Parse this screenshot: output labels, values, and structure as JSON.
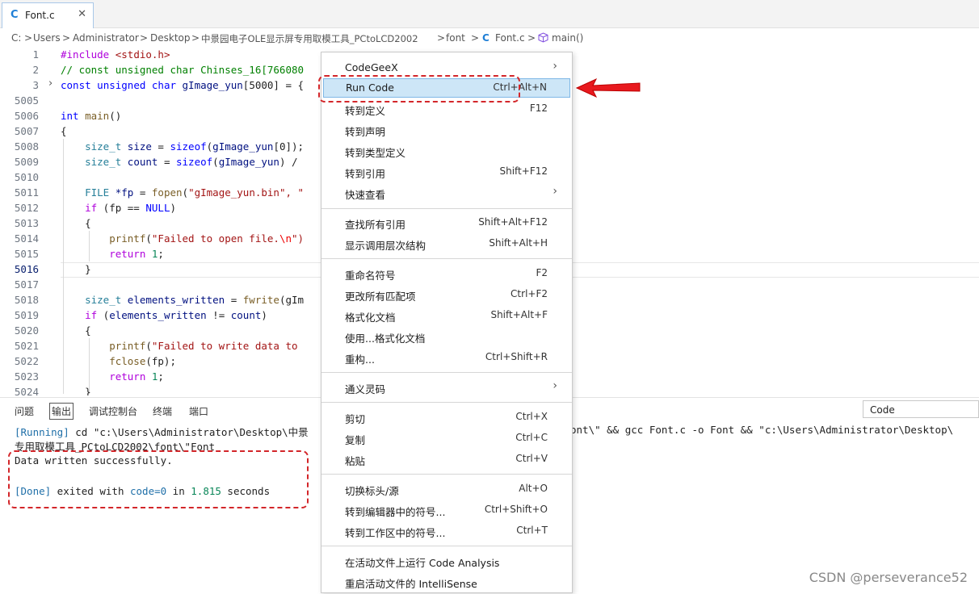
{
  "tab": {
    "icon": "C",
    "label": "Font.c",
    "close": "✕"
  },
  "breadcrumb": [
    "C:",
    "Users",
    "Administrator",
    "Desktop",
    "中景园电子OLE显示屏专用取模工具_PCtoLCD2002",
    "font",
    "Font.c",
    "main()"
  ],
  "breadcrumb_sep": ">",
  "breadcrumb_file_icon": "C",
  "gutter": [
    "1",
    "2",
    "3",
    "5005",
    "5006",
    "5007",
    "5008",
    "5009",
    "5010",
    "5011",
    "5012",
    "5013",
    "5014",
    "5015",
    "5016",
    "5017",
    "5018",
    "5019",
    "5020",
    "5021",
    "5022",
    "5023",
    "5024"
  ],
  "code": {
    "l1a": "#include",
    "l1b": " <stdio.h>",
    "l2": "// const unsigned char Chinses_16[766080",
    "l3a": "const",
    "l3b": " unsigned char",
    "l3c": " gImage_yun",
    "l3d": "[5000] = {",
    "l6a": "int",
    "l6b": " main",
    "l6c": "()",
    "l7": "{",
    "l8a": "    size_t",
    "l8b": " size",
    "l8c": " = ",
    "l8d": "sizeof",
    "l8e": "(",
    "l8f": "gImage_yun",
    "l8g": "[0]);",
    "l9a": "    size_t",
    "l9b": " count",
    "l9c": " = ",
    "l9d": "sizeof",
    "l9e": "(",
    "l9f": "gImage_yun",
    "l9g": ") /",
    "l11a": "    FILE",
    "l11b": " *fp",
    "l11c": " = ",
    "l11d": "fopen",
    "l11e": "(",
    "l11f": "\"gImage_yun.bin\"",
    "l11g": ", \"",
    "l12a": "    if",
    "l12b": " (fp == ",
    "l12c": "NULL",
    "l12d": ")",
    "l13": "    {",
    "l14a": "        printf",
    "l14b": "(",
    "l14c": "\"Failed to open file.",
    "l14d": "\\n",
    "l14e": "\")",
    "l15a": "        return",
    "l15b": " ",
    "l15c": "1",
    "l15d": ";",
    "l16": "    }",
    "l18a": "    size_t",
    "l18b": " elements_written",
    "l18c": " = ",
    "l18d": "fwrite",
    "l18e": "(gIm",
    "l19a": "    if",
    "l19b": " (",
    "l19c": "elements_written",
    "l19d": " != ",
    "l19e": "count",
    "l19f": ")",
    "l20": "    {",
    "l21a": "        printf",
    "l21b": "(",
    "l21c": "\"Failed to write data to",
    "l22a": "        fclose",
    "l22b": "(fp);",
    "l23a": "        return",
    "l23b": " ",
    "l23c": "1",
    "l23d": ";",
    "l24": "    }"
  },
  "panel": {
    "tabs": [
      "问题",
      "输出",
      "调试控制台",
      "终端",
      "端口"
    ],
    "active_tab": "输出",
    "filter_value": "Code",
    "out1a": "[Running]",
    "out1b": " cd \"c:\\Users\\Administrator\\Desktop\\中景",
    "out1c": "ont\\\" && gcc Font.c -o Font && \"c:\\Users\\Administrator\\Desktop\\",
    "out2": "专用取模工具_PCtoLCD2002\\font\\\"Font",
    "out3": "Data written successfully.",
    "out5a": "[Done]",
    "out5b": " exited with ",
    "out5c": "code=0",
    "out5d": " in ",
    "out5e": "1.815",
    "out5f": " seconds"
  },
  "menu": {
    "items": [
      {
        "label": "CodeGeeX",
        "shortcut": "",
        "submenu": true
      },
      {
        "label": "Run Code",
        "shortcut": "Ctrl+Alt+N"
      },
      {
        "label": "转到定义",
        "shortcut": "F12"
      },
      {
        "label": "转到声明",
        "shortcut": ""
      },
      {
        "label": "转到类型定义",
        "shortcut": ""
      },
      {
        "label": "转到引用",
        "shortcut": "Shift+F12"
      },
      {
        "label": "快速查看",
        "shortcut": "",
        "submenu": true
      },
      {
        "label": "查找所有引用",
        "shortcut": "Shift+Alt+F12"
      },
      {
        "label": "显示调用层次结构",
        "shortcut": "Shift+Alt+H"
      },
      {
        "label": "重命名符号",
        "shortcut": "F2"
      },
      {
        "label": "更改所有匹配项",
        "shortcut": "Ctrl+F2"
      },
      {
        "label": "格式化文档",
        "shortcut": "Shift+Alt+F"
      },
      {
        "label": "使用...格式化文档",
        "shortcut": ""
      },
      {
        "label": "重构...",
        "shortcut": "Ctrl+Shift+R"
      },
      {
        "label": "通义灵码",
        "shortcut": "",
        "submenu": true
      },
      {
        "label": "剪切",
        "shortcut": "Ctrl+X"
      },
      {
        "label": "复制",
        "shortcut": "Ctrl+C"
      },
      {
        "label": "粘贴",
        "shortcut": "Ctrl+V"
      },
      {
        "label": "切换标头/源",
        "shortcut": "Alt+O"
      },
      {
        "label": "转到编辑器中的符号...",
        "shortcut": "Ctrl+Shift+O"
      },
      {
        "label": "转到工作区中的符号...",
        "shortcut": "Ctrl+T"
      },
      {
        "label": "在活动文件上运行 Code Analysis",
        "shortcut": ""
      },
      {
        "label": "重启活动文件的 IntelliSense",
        "shortcut": ""
      }
    ],
    "submenu_arrow": "›"
  },
  "watermark": "CSDN @perseverance52",
  "colors": {
    "highlight_ring": "#d3262a",
    "menu_highlight": "#cde6f7",
    "arrow": "#e8191e"
  }
}
